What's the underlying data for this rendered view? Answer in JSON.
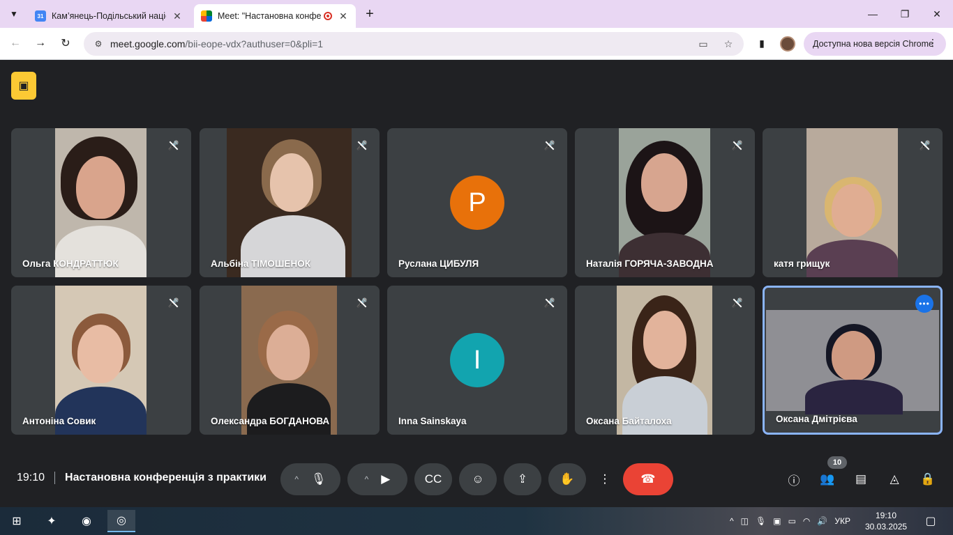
{
  "browser": {
    "tabs": [
      {
        "title": "Кам’янець-Подільський націо",
        "active": false
      },
      {
        "title": "Meet: \"Настановна конфер",
        "active": true
      }
    ],
    "url_host": "meet.google.com",
    "url_path": "/bii-eope-vdx?authuser=0&pli=1",
    "update_label": "Доступна нова версія Chrome"
  },
  "participants": [
    {
      "name": "Ольга КОНДРАТТЮК",
      "muted": true
    },
    {
      "name": "Альбіна ТІМОШЕНОК",
      "muted": true
    },
    {
      "name": "Руслана ЦИБУЛЯ",
      "muted": true,
      "initial": "Р",
      "color": "#e8710a"
    },
    {
      "name": "Наталія ГОРЯЧА-ЗАВОДНА",
      "muted": true
    },
    {
      "name": "катя грищук",
      "muted": true
    },
    {
      "name": "Антоніна Совик",
      "muted": true
    },
    {
      "name": "Олександра БОГДАНОВА",
      "muted": true
    },
    {
      "name": "Inna Sainskaya",
      "muted": true,
      "initial": "I",
      "color": "#12a4af"
    },
    {
      "name": "Оксана Байталоха",
      "muted": true
    },
    {
      "name": "Оксана Дмітрієва",
      "muted": false
    }
  ],
  "meeting": {
    "time": "19:10",
    "title": "Настановна конференція з практики",
    "participant_count": "10"
  },
  "taskbar": {
    "language": "УКР",
    "clock_time": "19:10",
    "clock_date": "30.03.2025"
  },
  "colors": {
    "meet_bg": "#202124",
    "tile_bg": "#3c4043",
    "hangup": "#ea4335",
    "warning": "#fcc934",
    "self_border": "#8ab4f8"
  }
}
